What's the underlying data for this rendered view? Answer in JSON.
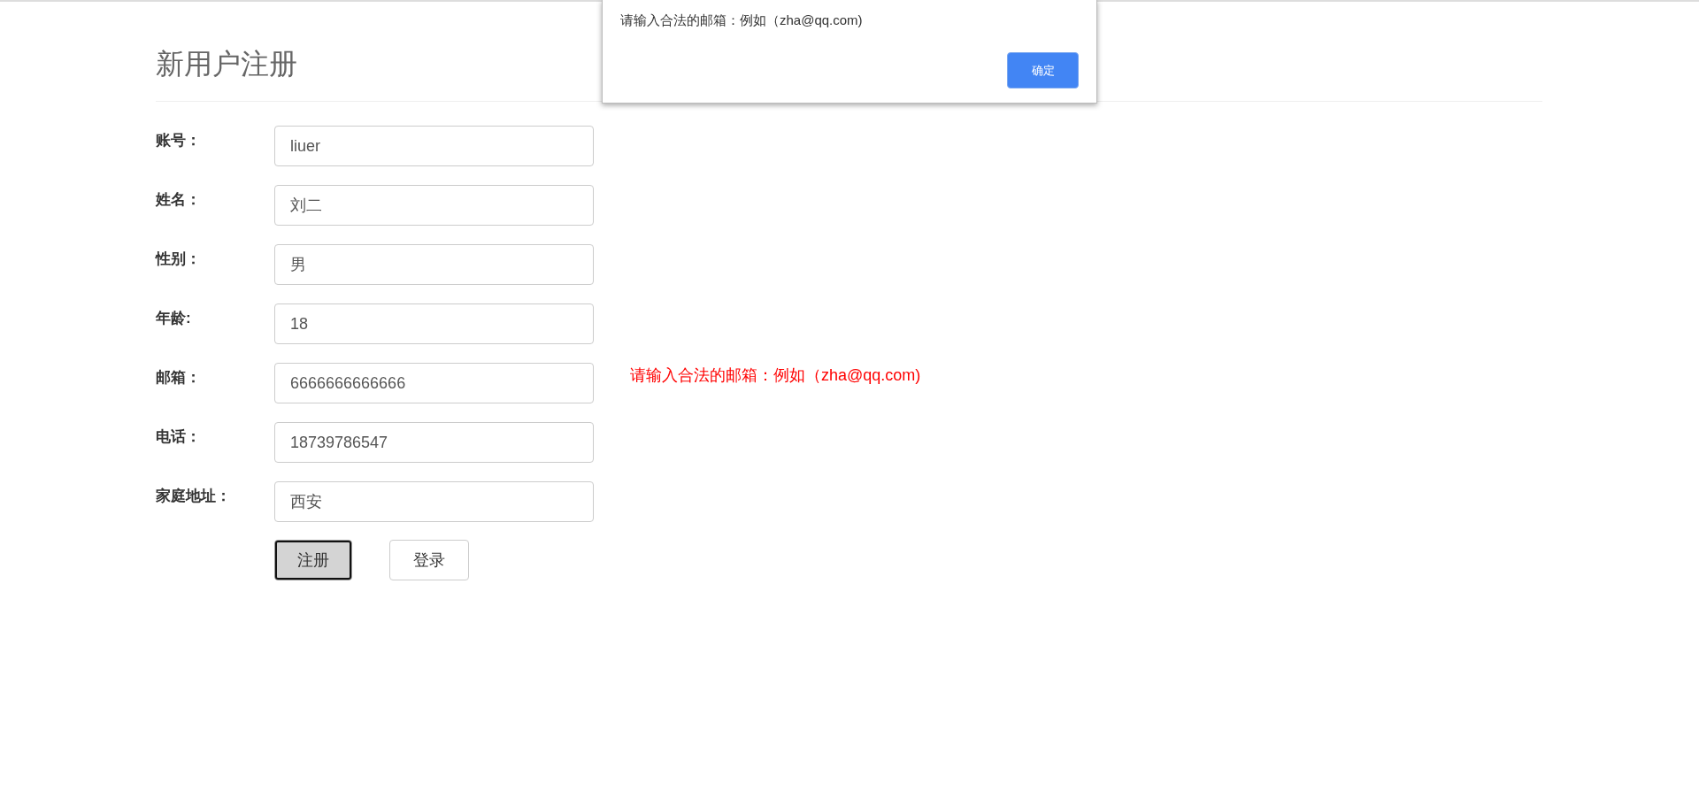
{
  "title": "新用户注册",
  "fields": [
    {
      "label": "账号：",
      "value": "liuer"
    },
    {
      "label": "姓名：",
      "value": "刘二"
    },
    {
      "label": "性别：",
      "value": "男"
    },
    {
      "label": "年龄:",
      "value": "18"
    },
    {
      "label": "邮箱：",
      "value": "6666666666666",
      "error": "请输入合法的邮箱：例如（zha@qq.com)"
    },
    {
      "label": "电话：",
      "value": "18739786547"
    },
    {
      "label": "家庭地址：",
      "value": "西安"
    }
  ],
  "buttons": [
    {
      "label": "注册",
      "focused": true
    },
    {
      "label": "登录",
      "focused": false
    }
  ],
  "dialog": {
    "message": "请输入合法的邮箱：例如（zha@qq.com)",
    "button": "确定"
  }
}
